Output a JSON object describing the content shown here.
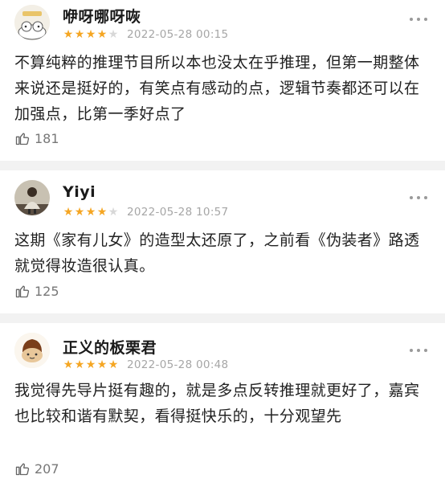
{
  "colors": {
    "star_filled": "#f5a623",
    "star_empty": "#d8d8d8",
    "date_text": "#a6a6a6",
    "divider": "#f2f2f2"
  },
  "reviews": [
    {
      "username": "咿呀哪呀咴",
      "rating": 4,
      "rating_max": 5,
      "date": "2022-05-28 00:15",
      "content": "不算纯粹的推理节目所以本也没太在乎推理，但第一期整体来说还是挺好的，有笑点有感动的点，逻辑节奏都还可以在加强点，比第一季好点了",
      "likes": "181",
      "avatar_icon": "cartoon-cat-avatar"
    },
    {
      "username": "Yiyi",
      "rating": 4,
      "rating_max": 5,
      "date": "2022-05-28 10:57",
      "content": "这期《家有儿女》的造型太还原了，之前看《伪装者》路透就觉得妆造很认真。",
      "likes": "125",
      "avatar_icon": "photo-avatar"
    },
    {
      "username": "正义的板栗君",
      "rating": 5,
      "rating_max": 5,
      "date": "2022-05-28 00:48",
      "content": "我觉得先导片挺有趣的，就是多点反转推理就更好了，嘉宾也比较和谐有默契，看得挺快乐的，十分观望先",
      "likes": "207",
      "avatar_icon": "chestnut-avatar"
    }
  ],
  "icons": {
    "like": "thumbs-up-icon",
    "more": "more-dots-icon"
  }
}
